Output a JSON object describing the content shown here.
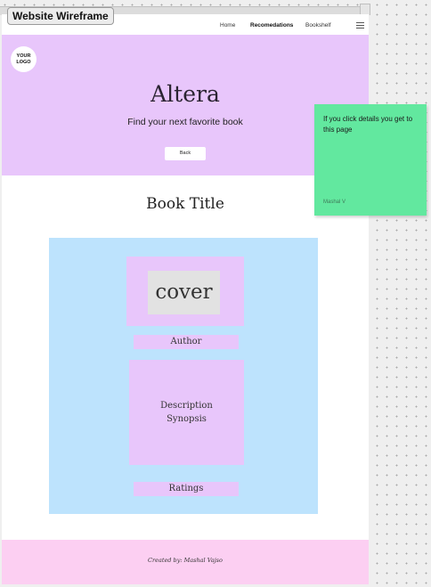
{
  "frame": {
    "title": "Website Wireframe"
  },
  "nav": {
    "links": [
      {
        "label": "Home",
        "active": false
      },
      {
        "label": "Recomedations",
        "active": true
      },
      {
        "label": "Bookshelf",
        "active": false
      }
    ],
    "menu_icon": "hamburger-menu-icon"
  },
  "hero": {
    "logo_text": "YOUR\nLOGO",
    "title": "Altera",
    "subtitle": "Find your next favorite book",
    "back_label": "Back"
  },
  "book": {
    "title": "Book Title",
    "cover_label": "cover",
    "author_label": "Author",
    "description_label": "Description",
    "synopsis_label": "Synopsis",
    "ratings_label": "Ratings"
  },
  "footer": {
    "credit": "Created by: Mashal Vajso"
  },
  "sticky_note": {
    "text": "If you click details you get to this page",
    "author": "Mashal V"
  },
  "colors": {
    "hero_bg": "#e8c6fb",
    "content_bg": "#bde3fd",
    "card_bg": "#e8c6fb",
    "cover_bg": "#e2e2e2",
    "footer_bg": "#fccff2",
    "sticky_bg": "#62e89f",
    "canvas_bg": "#efefef"
  }
}
